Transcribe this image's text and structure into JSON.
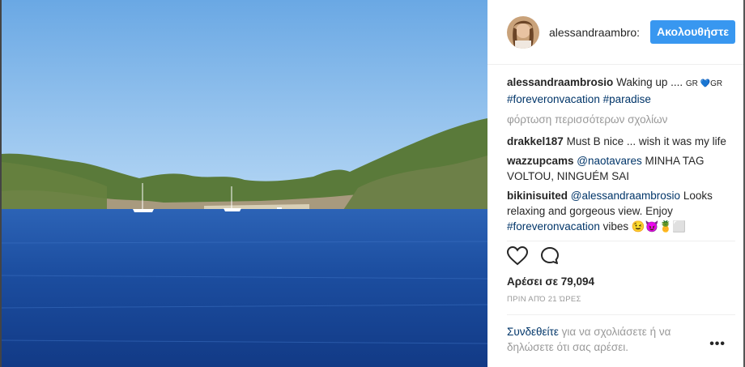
{
  "post": {
    "username": "alessandraambrosio",
    "header_username": "alessandraambro:",
    "follow_label": "Ακολουθήστε",
    "caption": {
      "username": "alessandraambrosio",
      "text": "Waking up .... ",
      "emoji": "GR 💙GR",
      "tags": [
        "#foreveronvacation",
        "#paradise"
      ]
    },
    "load_more": "φόρτωση περισσότερων σχολίων",
    "comments": [
      {
        "username": "drakkel187",
        "text": "Must B nice ... wish it was my life"
      },
      {
        "username": "wazzupcams",
        "mention": "@naotavares",
        "text": " MINHA TAG VOLTOU, NINGUÉM SAI"
      },
      {
        "username": "bikinisuited",
        "mention": "@alessandraambrosio",
        "text": " Looks relaxing and gorgeous view. Enjoy ",
        "tag": "#foreveronvacation",
        "tail": " vibes 😉😈🍍⬜"
      }
    ],
    "likes_label": "Αρέσει σε 79,094",
    "time_ago": "ΠΡΙΝ ΑΠΌ 21 ΏΡΕΣ",
    "login_link": "Συνδεθείτε",
    "login_text": " για να σχολιάσετε ή να δηλώσετε ότι σας αρέσει.",
    "more_label": "•••"
  },
  "icons": {
    "like": "heart-icon",
    "comment": "comment-icon",
    "more": "more-icon"
  },
  "colors": {
    "accent": "#3897f0",
    "link": "#003569",
    "muted": "#999999"
  }
}
